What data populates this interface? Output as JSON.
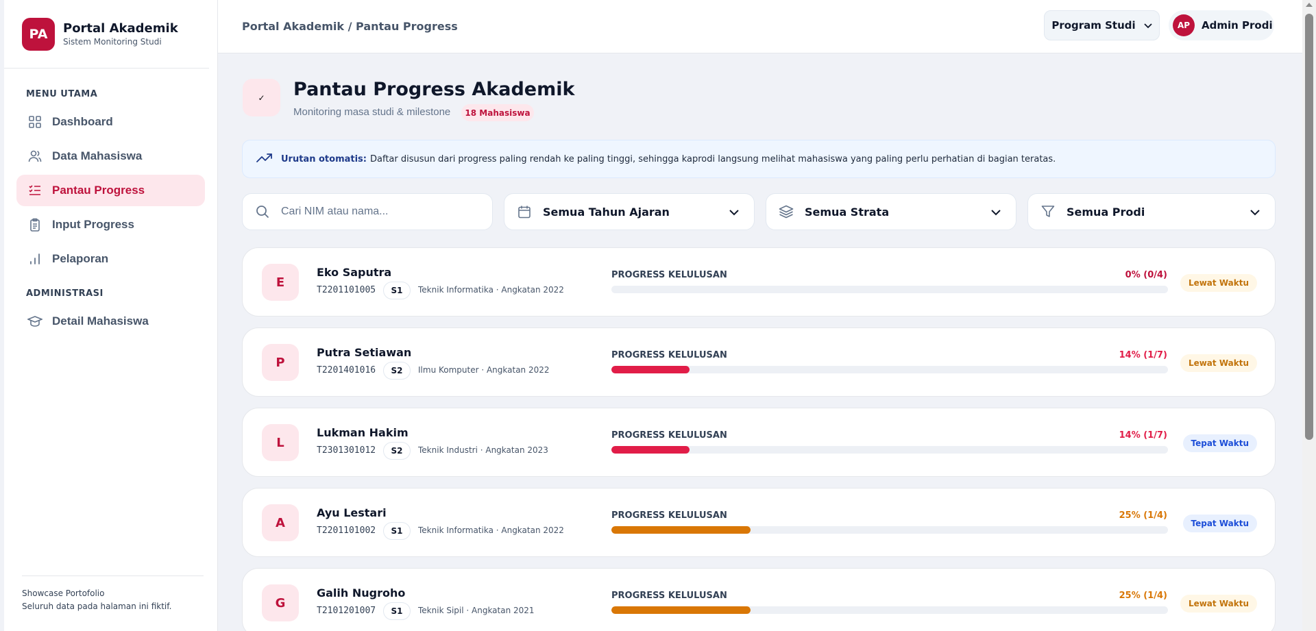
{
  "brand": {
    "logo": "PA",
    "title": "Portal Akademik",
    "subtitle": "Sistem Monitoring Studi"
  },
  "sidebar": {
    "sections": [
      {
        "title": "MENU UTAMA"
      },
      {
        "title": "ADMINISTRASI"
      }
    ],
    "items": [
      {
        "label": "Dashboard",
        "icon": "grid-icon",
        "active": false
      },
      {
        "label": "Data Mahasiswa",
        "icon": "users-icon",
        "active": false
      },
      {
        "label": "Pantau Progress",
        "icon": "list-progress-icon",
        "active": true
      },
      {
        "label": "Input Progress",
        "icon": "clipboard-icon",
        "active": false
      },
      {
        "label": "Pelaporan",
        "icon": "bar-chart-icon",
        "active": false
      },
      {
        "label": "Detail Mahasiswa",
        "icon": "graduation-cap-icon",
        "active": false
      }
    ],
    "footer": {
      "line1": "Showcase Portofolio",
      "line2": "Seluruh data pada halaman ini fiktif."
    }
  },
  "topbar": {
    "breadcrumb": "Portal Akademik / Pantau Progress",
    "program_select": "Program Studi",
    "user": {
      "initials": "AP",
      "name": "Admin Prodi"
    }
  },
  "page": {
    "icon": "✓",
    "title": "Pantau Progress Akademik",
    "subtitle": "Monitoring masa studi & milestone",
    "count_badge": "18 Mahasiswa"
  },
  "info": {
    "label": "Urutan otomatis:",
    "text": "Daftar disusun dari progress paling rendah ke paling tinggi, sehingga kaprodi langsung melihat mahasiswa yang paling perlu perhatian di bagian teratas."
  },
  "filters": {
    "search_placeholder": "Cari NIM atau nama...",
    "tahun": "Semua Tahun Ajaran",
    "strata": "Semua Strata",
    "prodi": "Semua Prodi"
  },
  "progress_label": "PROGRESS KELULUSAN",
  "students": [
    {
      "initial": "E",
      "name": "Eko Saputra",
      "nim": "T2201101005",
      "strata": "S1",
      "prodi": "Teknik Informatika · Angkatan 2022",
      "percent_text": "0% (0/4)",
      "progress": 0,
      "color": "#be123c",
      "status": "Lewat Waktu",
      "status_type": "late"
    },
    {
      "initial": "P",
      "name": "Putra Setiawan",
      "nim": "T2201401016",
      "strata": "S2",
      "prodi": "Ilmu Komputer · Angkatan 2022",
      "percent_text": "14% (1/7)",
      "progress": 0.14,
      "color": "#e11d48",
      "status": "Lewat Waktu",
      "status_type": "late"
    },
    {
      "initial": "L",
      "name": "Lukman Hakim",
      "nim": "T2301301012",
      "strata": "S2",
      "prodi": "Teknik Industri · Angkatan 2023",
      "percent_text": "14% (1/7)",
      "progress": 0.14,
      "color": "#e11d48",
      "status": "Tepat Waktu",
      "status_type": "ontime"
    },
    {
      "initial": "A",
      "name": "Ayu Lestari",
      "nim": "T2201101002",
      "strata": "S1",
      "prodi": "Teknik Informatika · Angkatan 2022",
      "percent_text": "25% (1/4)",
      "progress": 0.25,
      "color": "#d97706",
      "status": "Tepat Waktu",
      "status_type": "ontime"
    },
    {
      "initial": "G",
      "name": "Galih Nugroho",
      "nim": "T2101201007",
      "strata": "S1",
      "prodi": "Teknik Sipil · Angkatan 2021",
      "percent_text": "25% (1/4)",
      "progress": 0.25,
      "color": "#d97706",
      "status": "Lewat Waktu",
      "status_type": "late"
    }
  ]
}
